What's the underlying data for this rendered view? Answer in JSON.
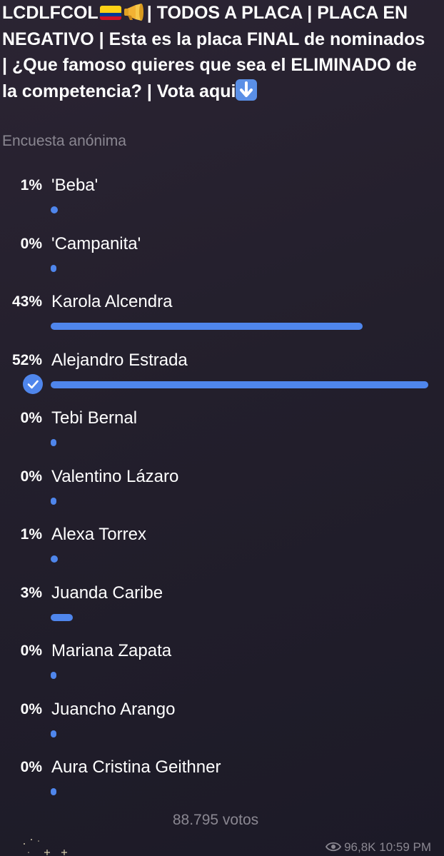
{
  "poll": {
    "question": {
      "part1": "LCDLFCOL",
      "part2": "| TODOS A PLACA | PLACA EN NEGATIVO | Esta es la placa FINAL de nominados | ¿Que famoso quieres que sea el ELIMINADO de la competencia? | Vota aqui",
      "icons": [
        "colombia-flag-icon",
        "megaphone-icon",
        "down-arrow-emoji-icon"
      ]
    },
    "type_label": "Encuesta anónima",
    "options": [
      {
        "percent_label": "1%",
        "name": "'Beba'",
        "percent": 1,
        "selected": false
      },
      {
        "percent_label": "0%",
        "name": "'Campanita'",
        "percent": 0,
        "selected": false
      },
      {
        "percent_label": "43%",
        "name": "Karola Alcendra",
        "percent": 43,
        "selected": false
      },
      {
        "percent_label": "52%",
        "name": "Alejandro Estrada",
        "percent": 52,
        "selected": true
      },
      {
        "percent_label": "0%",
        "name": "Tebi Bernal",
        "percent": 0,
        "selected": false
      },
      {
        "percent_label": "0%",
        "name": "Valentino Lázaro",
        "percent": 0,
        "selected": false
      },
      {
        "percent_label": "1%",
        "name": "Alexa Torrex",
        "percent": 1,
        "selected": false
      },
      {
        "percent_label": "3%",
        "name": "Juanda Caribe",
        "percent": 3,
        "selected": false
      },
      {
        "percent_label": "0%",
        "name": "Mariana Zapata",
        "percent": 0,
        "selected": false
      },
      {
        "percent_label": "0%",
        "name": "Juancho Arango",
        "percent": 0,
        "selected": false
      },
      {
        "percent_label": "0%",
        "name": "Aura Cristina Geithner",
        "percent": 0,
        "selected": false
      }
    ],
    "total_votes": "88.795 votos",
    "views": "96,8K",
    "time": "10:59 PM",
    "colors": {
      "accent": "#4f86ec",
      "muted_text": "#8a8791",
      "background": "#231f2c"
    }
  }
}
